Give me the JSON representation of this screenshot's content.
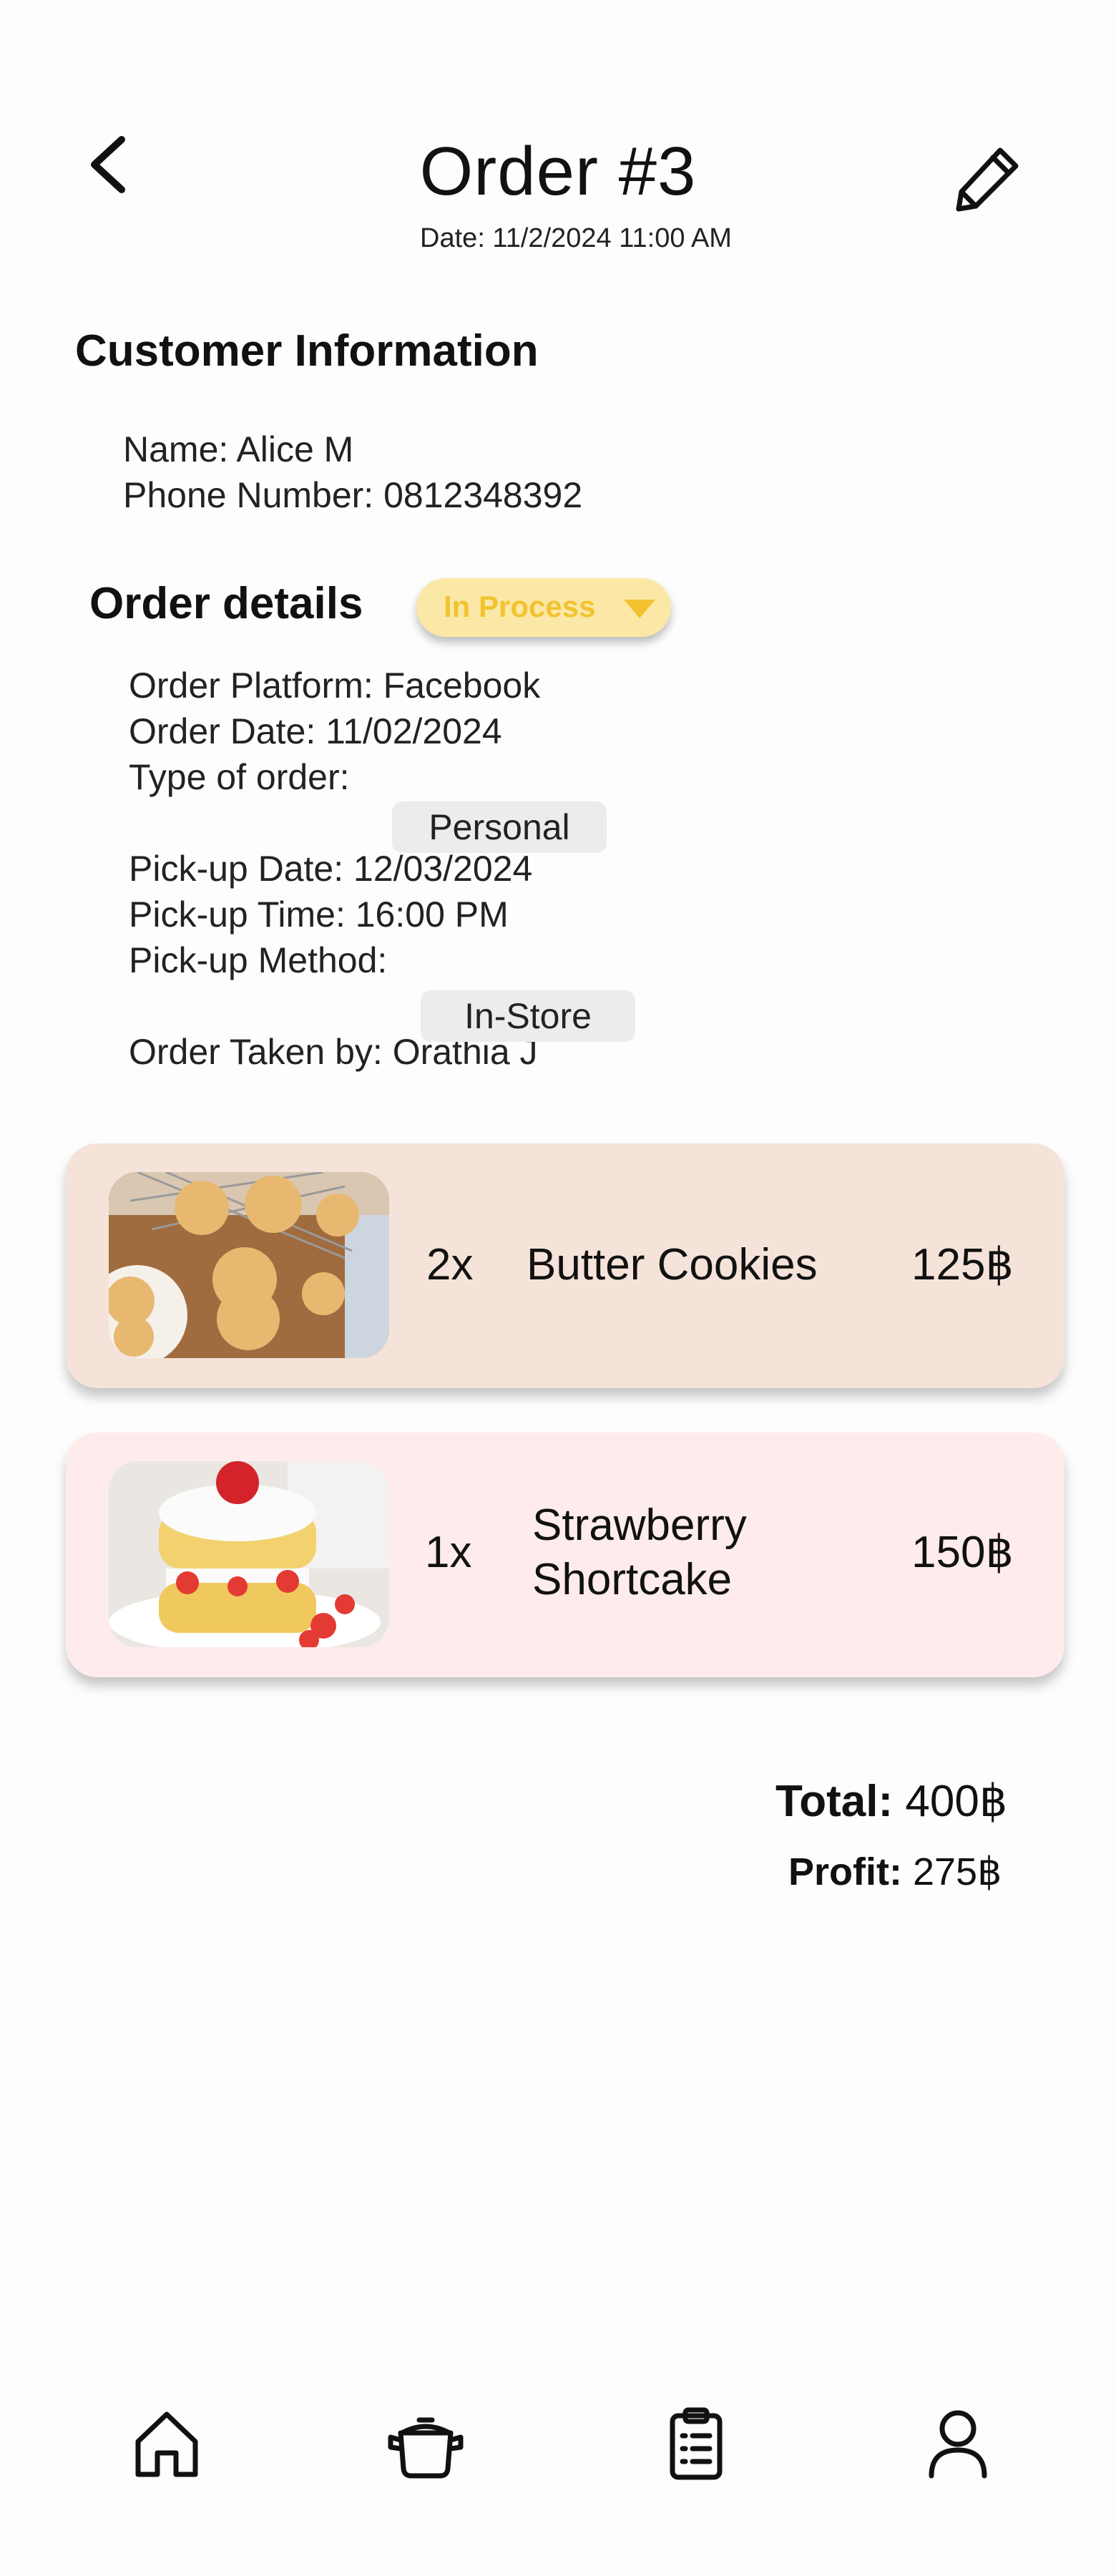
{
  "header": {
    "title": "Order #3",
    "date": "Date: 11/2/2024 11:00 AM"
  },
  "customer": {
    "heading": "Customer Information",
    "name": "Name: Alice M",
    "phone": "Phone Number: 0812348392"
  },
  "order_details": {
    "heading": "Order details",
    "status": "In Process",
    "platform": "Order Platform: Facebook",
    "order_date": "Order Date: 11/02/2024",
    "type_label": "Type of order:",
    "type_value": "Personal",
    "pickup_date": "Pick-up Date: 12/03/2024",
    "pickup_time": "Pick-up Time: 16:00 PM",
    "pickup_method_label": "Pick-up Method:",
    "pickup_method_value": "In-Store",
    "taken_by": "Order Taken by: Orathia J"
  },
  "items": [
    {
      "qty": "2x",
      "name": "Butter Cookies",
      "price": "125฿",
      "bg": "#f5e3da"
    },
    {
      "qty": "1x",
      "name_line1": "Strawberry",
      "name_line2": "Shortcake",
      "price": "150฿",
      "bg": "#feecec"
    }
  ],
  "summary": {
    "total_label": "Total:",
    "total_value": "400฿",
    "profit_label": "Profit:",
    "profit_value": "275฿"
  },
  "nav": [
    "home-icon",
    "pot-icon",
    "clipboard-icon",
    "user-icon"
  ],
  "colors": {
    "status_bg": "#fbe8a6",
    "status_text": "#f2c22f"
  }
}
